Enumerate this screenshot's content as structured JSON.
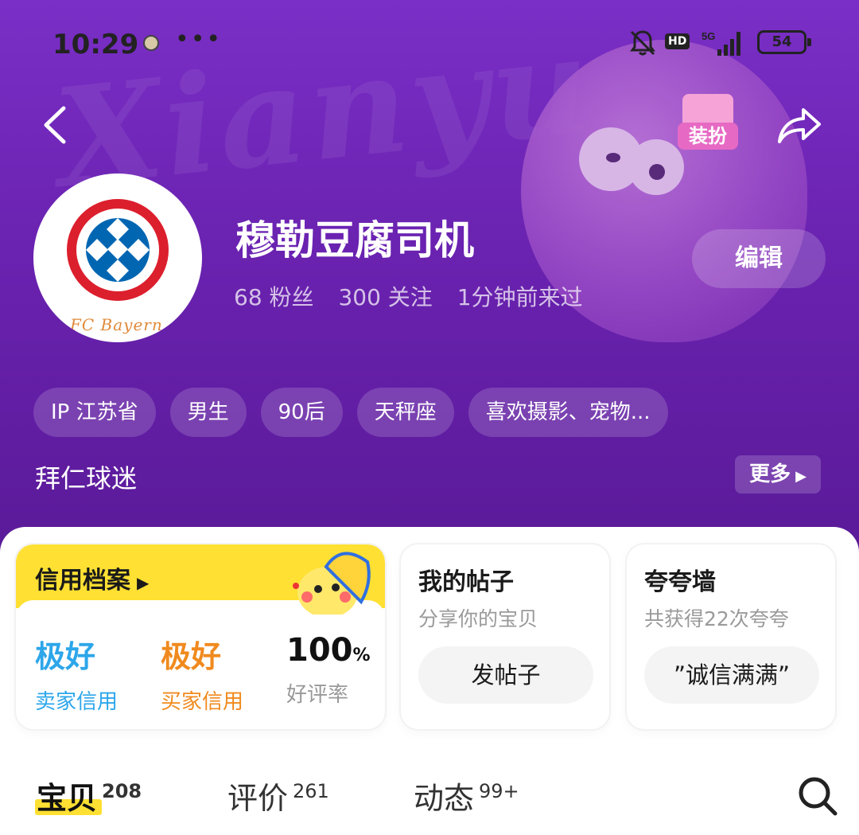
{
  "status_bar": {
    "time": "10:29",
    "more": "•••",
    "hd": "HD",
    "network": "5G",
    "battery": "54"
  },
  "header": {
    "background_text": "Xianyu",
    "dressup_label": "装扮"
  },
  "profile": {
    "avatar_caption": "FC Bayern",
    "nickname": "穆勒豆腐司机",
    "fans": "68 粉丝",
    "following": "300 关注",
    "last_seen": "1分钟前来过",
    "edit_label": "编辑",
    "tags": [
      "IP 江苏省",
      "男生",
      "90后",
      "天秤座",
      "喜欢摄影、宠物..."
    ],
    "bio": "拜仁球迷",
    "more_label": "更多"
  },
  "cards": {
    "credit": {
      "title": "信用档案",
      "seller_value": "极好",
      "seller_label": "卖家信用",
      "buyer_value": "极好",
      "buyer_label": "买家信用",
      "rate_value": "100",
      "rate_unit": "%",
      "rate_label": "好评率"
    },
    "posts": {
      "title": "我的帖子",
      "subtitle": "分享你的宝贝",
      "button": "发帖子"
    },
    "praise": {
      "title": "夸夸墙",
      "subtitle": "共获得22次夸夸",
      "button": "”诚信满满”"
    }
  },
  "tabs": [
    {
      "label": "宝贝",
      "count": "208"
    },
    {
      "label": "评价",
      "count": "261"
    },
    {
      "label": "动态",
      "count": "99+"
    }
  ],
  "colors": {
    "header": "#6a22b0",
    "accent_yellow": "#ffe033",
    "seller_blue": "#2da6ea",
    "buyer_orange": "#f08a1e"
  }
}
